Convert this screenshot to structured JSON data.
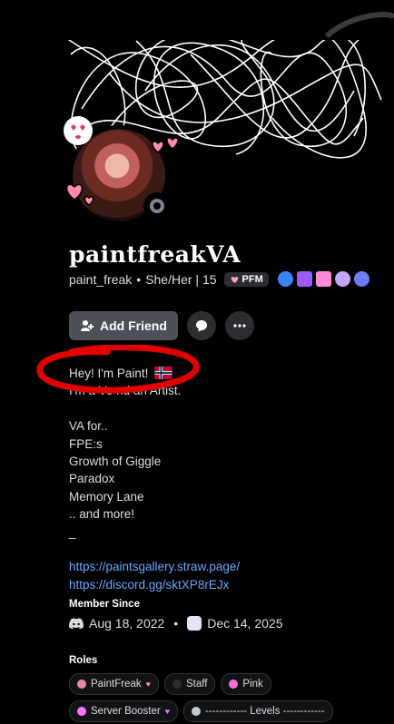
{
  "profile": {
    "display_name": "paintfreakVA",
    "username": "paint_freak",
    "pronouns_age": "She/Her | 15",
    "clan_tag": "PFM",
    "status_icon": "offline-status-icon"
  },
  "actions": {
    "add_friend_label": "Add Friend",
    "message_icon": "chat-bubble-icon",
    "more_icon": "more-horizontal-icon"
  },
  "bio": {
    "line1": "Hey! I'm Paint!",
    "line2": "I'm a Vo          nd an Artist.",
    "line3": "",
    "line4": "VA for..",
    "line5": "FPE:s",
    "line6": "Growth of Giggle",
    "line7": "Paradox",
    "line8": "Memory Lane",
    "line9": ".. and more!",
    "line10": "_",
    "line11": "",
    "link1": "https://paintsgallery.straw.page/",
    "link2": "https://discord.gg/sktXP8rEJx"
  },
  "member_since": {
    "title": "Member Since",
    "discord_date": "Aug 18, 2022",
    "server_date": "Dec 14, 2025"
  },
  "roles": {
    "title": "Roles",
    "items": [
      {
        "label": "PaintFreak",
        "color": "#e88aa8"
      },
      {
        "label": "Staff",
        "color": "#2b2d31"
      },
      {
        "label": "Pink",
        "color": "#ff6fd8"
      },
      {
        "label": "Server Booster",
        "color": "#ff73fa"
      },
      {
        "label": "------------ Levels ------------",
        "color": "#c4c9ce"
      }
    ]
  },
  "colors": {
    "link": "#6aa6ff",
    "annotation_red": "#e00000"
  }
}
